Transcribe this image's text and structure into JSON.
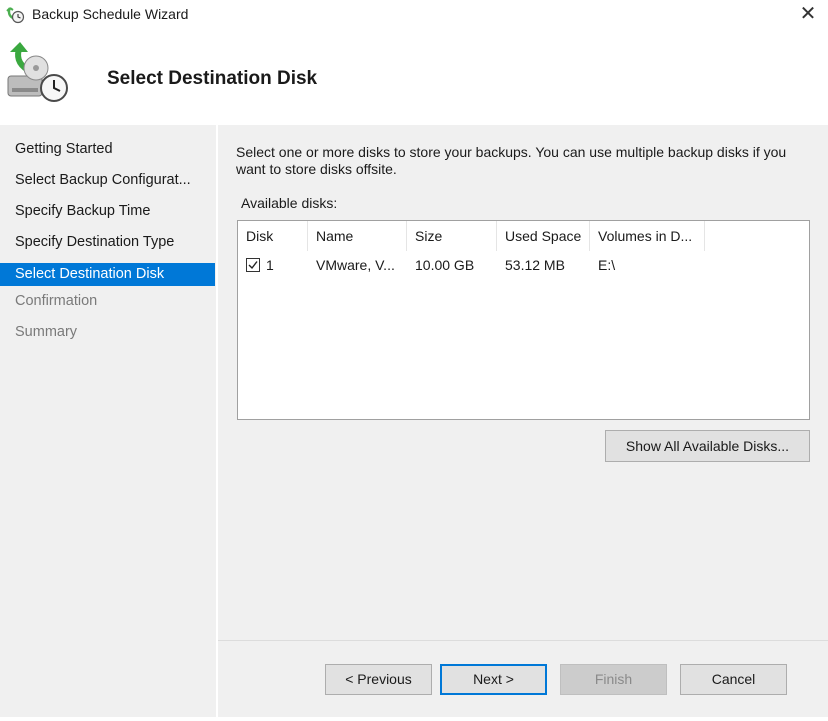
{
  "window": {
    "title": "Backup Schedule Wizard",
    "close_glyph": "✕",
    "app_icon": "backup-clock-icon"
  },
  "header": {
    "title": "Select Destination Disk",
    "icon": "backup-disk-clock-icon"
  },
  "nav": {
    "items": [
      {
        "label": "Getting Started",
        "state": "normal"
      },
      {
        "label": "Select Backup Configurat...",
        "state": "normal"
      },
      {
        "label": "Specify Backup Time",
        "state": "normal"
      },
      {
        "label": "Specify Destination Type",
        "state": "normal"
      },
      {
        "label": "Select Destination Disk",
        "state": "selected"
      },
      {
        "label": "Confirmation",
        "state": "disabled"
      },
      {
        "label": "Summary",
        "state": "disabled"
      }
    ]
  },
  "content": {
    "instruction": "Select one or more disks to store your backups. You can use multiple backup disks if you want to store disks offsite.",
    "available_label": "Available disks:",
    "columns": [
      "Disk",
      "Name",
      "Size",
      "Used Space",
      "Volumes in D..."
    ],
    "rows": [
      {
        "checked": true,
        "disk": "1",
        "name": "VMware, V...",
        "size": "10.00 GB",
        "used": "53.12 MB",
        "volumes": "E:\\"
      }
    ],
    "show_all_label": "Show All Available Disks..."
  },
  "footer": {
    "previous_label": "< Previous",
    "next_label": "Next >",
    "finish_label": "Finish",
    "cancel_label": "Cancel"
  },
  "colors": {
    "accent": "#0078d7",
    "panel": "#f0f0f0"
  }
}
